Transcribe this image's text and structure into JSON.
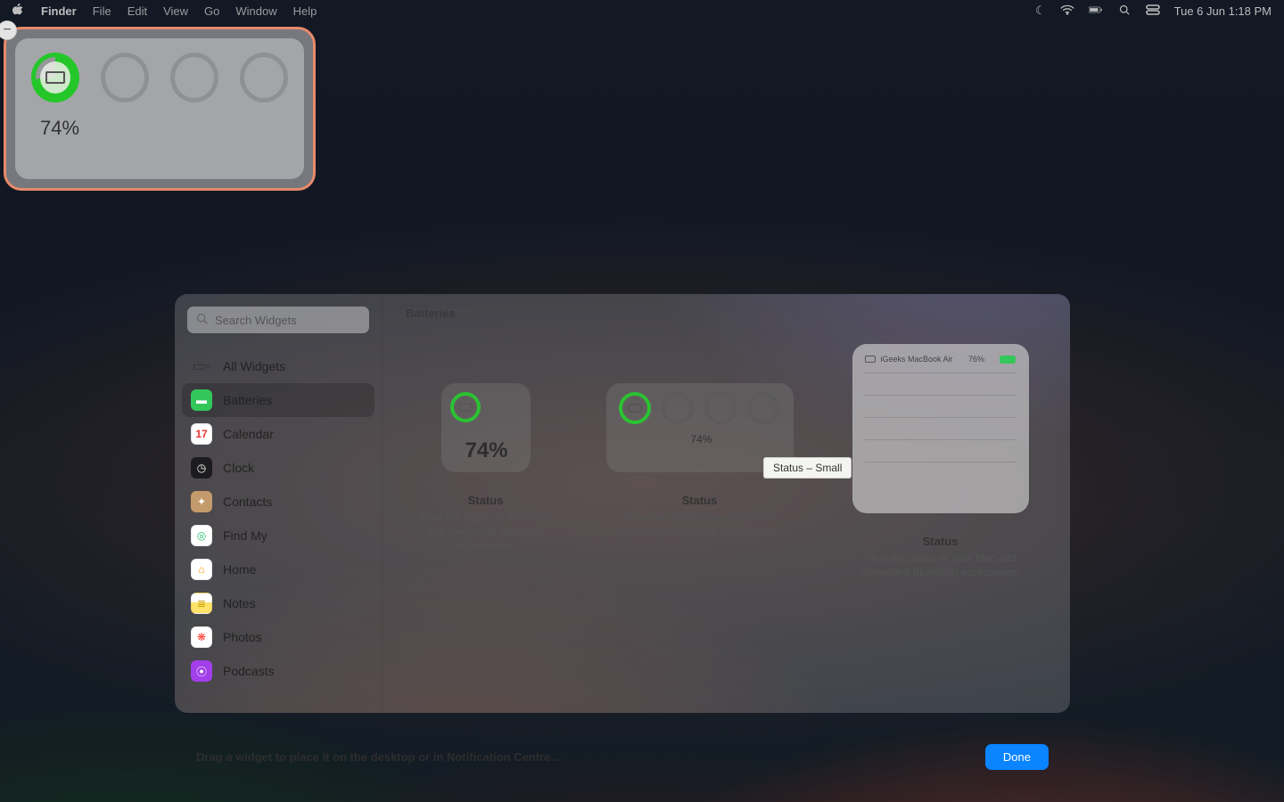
{
  "menubar": {
    "app": "Finder",
    "items": [
      "File",
      "Edit",
      "View",
      "Go",
      "Window",
      "Help"
    ],
    "clock": "Tue 6 Jun  1:18 PM"
  },
  "desktop_widget": {
    "remove": "−",
    "pct": "74%"
  },
  "gallery": {
    "search_placeholder": "Search Widgets",
    "sidebar": [
      {
        "label": "All Widgets",
        "iconClass": "icon-all",
        "glyph": "▭▫"
      },
      {
        "label": "Batteries",
        "iconClass": "icon-batt",
        "glyph": "▬",
        "selected": true
      },
      {
        "label": "Calendar",
        "iconClass": "icon-cal",
        "glyph": "17"
      },
      {
        "label": "Clock",
        "iconClass": "icon-clock",
        "glyph": "◷"
      },
      {
        "label": "Contacts",
        "iconClass": "icon-contacts",
        "glyph": "✦"
      },
      {
        "label": "Find My",
        "iconClass": "icon-findmy",
        "glyph": "◎"
      },
      {
        "label": "Home",
        "iconClass": "icon-home",
        "glyph": "⌂"
      },
      {
        "label": "Notes",
        "iconClass": "icon-notes",
        "glyph": "≣"
      },
      {
        "label": "Photos",
        "iconClass": "icon-photos",
        "glyph": "✿"
      },
      {
        "label": "Podcasts",
        "iconClass": "icon-podcasts",
        "glyph": "⦿"
      }
    ],
    "title": "Batteries",
    "tooltip": "Status – Small",
    "columns": [
      {
        "name": "Status",
        "desc": "View the status of your Mac and connected Bluetooth accessories.",
        "pct": "74%"
      },
      {
        "name": "Status",
        "desc": "View the status of your Mac and connected Bluetooth accessories.",
        "pct": "74%"
      },
      {
        "name": "Status",
        "desc": "View the status of your Mac and connected Bluetooth accessories.",
        "device": "iGeeks MacBook Air",
        "pct": "76%"
      }
    ]
  },
  "footer": {
    "hint": "Drag a widget to place it on the desktop or in Notification Centre…",
    "done": "Done"
  }
}
